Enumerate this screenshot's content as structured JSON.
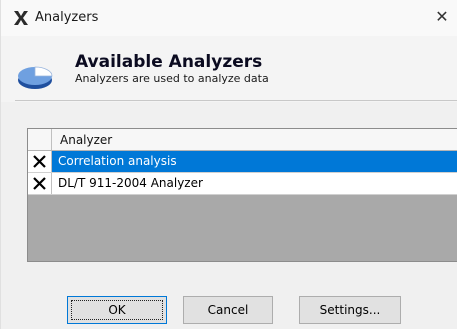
{
  "window": {
    "title": "Analyzers",
    "close_label": "✕"
  },
  "header": {
    "title": "Available Analyzers",
    "subtitle": "Analyzers are used to analyze data"
  },
  "grid": {
    "column_header": "Analyzer",
    "rows": [
      {
        "name": "Correlation analysis",
        "checked": true,
        "selected": true
      },
      {
        "name": "DL/T 911-2004 Analyzer",
        "checked": true,
        "selected": false
      }
    ]
  },
  "buttons": {
    "ok": "OK",
    "cancel": "Cancel",
    "settings": "Settings..."
  },
  "colors": {
    "selection": "#0078d7",
    "grid_background": "#a9a9a9"
  }
}
